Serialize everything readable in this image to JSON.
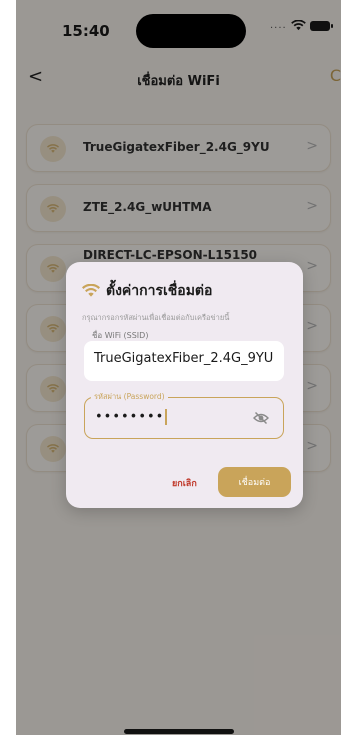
{
  "status_bar": {
    "time": "15:40",
    "signal_dots": "....",
    "wifi_icon": "wifi-icon",
    "battery_icon": "battery-icon"
  },
  "nav": {
    "back_icon": "chevron-left-icon",
    "back_glyph": "<",
    "title": "เชื่อมต่อ WiFi",
    "refresh_glyph": "C"
  },
  "networks": [
    {
      "ssid": "TrueGigatexFiber_2.4G_9YU"
    },
    {
      "ssid": "ZTE_2.4G_wUHTMA"
    },
    {
      "ssid": "DIRECT-LC-EPSON-L15150"
    },
    {
      "ssid": ""
    },
    {
      "ssid": ""
    },
    {
      "ssid": ""
    }
  ],
  "chevron_glyph": ">",
  "dialog": {
    "title": "ตั้งค่าการเชื่อมต่อ",
    "subtitle": "กรุณากรอกรหัสผ่านเพื่อเชื่อมต่อกับเครือข่ายนี้",
    "ssid_label": "ชื่อ WiFi (SSID)",
    "ssid_value": "TrueGigatexFiber_2.4G_9YU",
    "password_label": "รหัสผ่าน (Password)",
    "password_value": "••••••••",
    "cancel_label": "ยกเลิก",
    "connect_label": "เชื่อมต่อ"
  },
  "colors": {
    "accent": "#c9a45a",
    "cancel": "#c0392b",
    "dialog_bg": "#f0eaf1"
  }
}
